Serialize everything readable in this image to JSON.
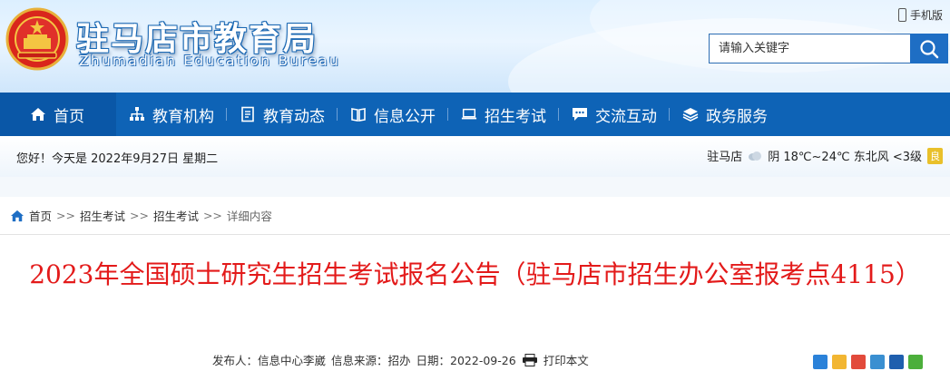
{
  "header": {
    "title": "驻马店市教育局",
    "subtitle": "Zhumadian Education Bureau",
    "mobile_label": "手机版",
    "search": {
      "placeholder": "请输入关键字"
    }
  },
  "nav": {
    "items": [
      {
        "label": "首页",
        "icon": "home-icon"
      },
      {
        "label": "教育机构",
        "icon": "org-chart-icon"
      },
      {
        "label": "教育动态",
        "icon": "document-icon"
      },
      {
        "label": "信息公开",
        "icon": "book-icon"
      },
      {
        "label": "招生考试",
        "icon": "laptop-icon"
      },
      {
        "label": "交流互动",
        "icon": "chat-icon"
      },
      {
        "label": "政务服务",
        "icon": "layers-icon"
      }
    ]
  },
  "datebar": {
    "greeting": "您好！今天是 2022年9月27日 星期二",
    "city": "驻马店",
    "weather": "阴 18℃~24℃ 东北风 <3级",
    "air_quality": "良"
  },
  "breadcrumb": {
    "items": [
      "首页",
      "招生考试",
      "招生考试"
    ],
    "separator": ">>",
    "current": "详细内容"
  },
  "article": {
    "title": "2023年全国硕士研究生招生考试报名公告（驻马店市招生办公室报考点4115）",
    "publisher": "发布人：信息中心李崴",
    "source": "信息来源：招办",
    "date": "日期：2022-09-26",
    "print_label": "打印本文"
  },
  "colors": {
    "nav_bg": "#0e63b6",
    "nav_active": "#0a57a7",
    "title_red": "#e31a1a",
    "search_btn": "#1e6ec4"
  }
}
